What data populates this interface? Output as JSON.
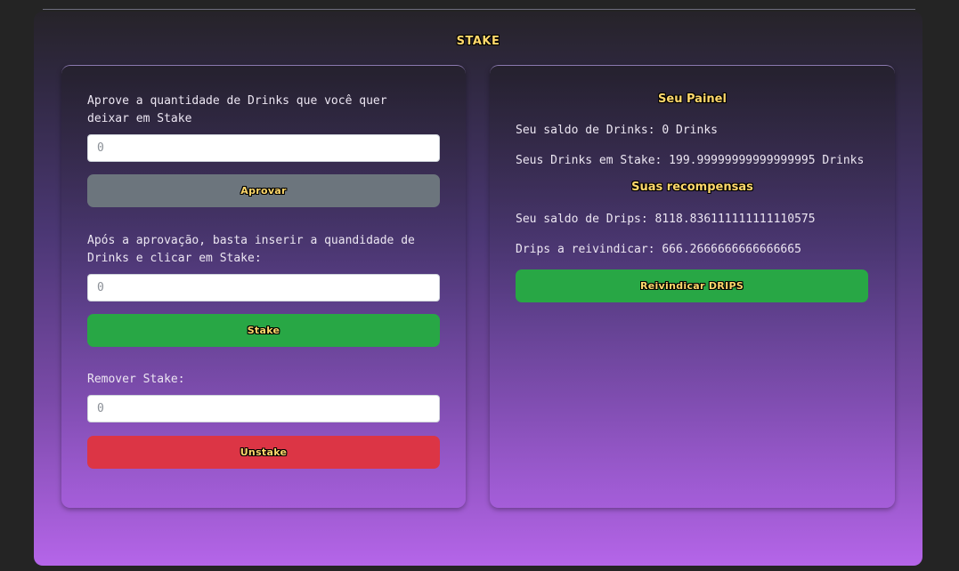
{
  "header": {
    "title": "STAKE"
  },
  "stake_form": {
    "approve_label": "Aprove a quantidade de Drinks que você quer deixar em Stake",
    "approve_placeholder": "0",
    "approve_button": "Aprovar",
    "stake_label": "Após a aprovação, basta inserir a quandidade de Drinks e clicar em Stake:",
    "stake_placeholder": "0",
    "stake_button": "Stake",
    "unstake_label": "Remover Stake:",
    "unstake_placeholder": "0",
    "unstake_button": "Unstake"
  },
  "dashboard": {
    "title": "Seu Painel",
    "drinks_balance": "Seu saldo de Drinks: 0 Drinks",
    "drinks_staked": "Seus Drinks em Stake: 199.99999999999999995 Drinks",
    "rewards_title": "Suas recompensas",
    "drips_balance": "Seu saldo de Drips: 8118.836111111111110575",
    "drips_claimable": "Drips a reivindicar: 666.2666666666666665",
    "claim_button": "Reivindicar DRIPS"
  },
  "colors": {
    "title_text": "#ffd86b",
    "approve_button_bg": "#6c757d",
    "stake_button_bg": "#28a745",
    "unstake_button_bg": "#dc3545",
    "claim_button_bg": "#28a745",
    "page_bg": "#242424"
  }
}
